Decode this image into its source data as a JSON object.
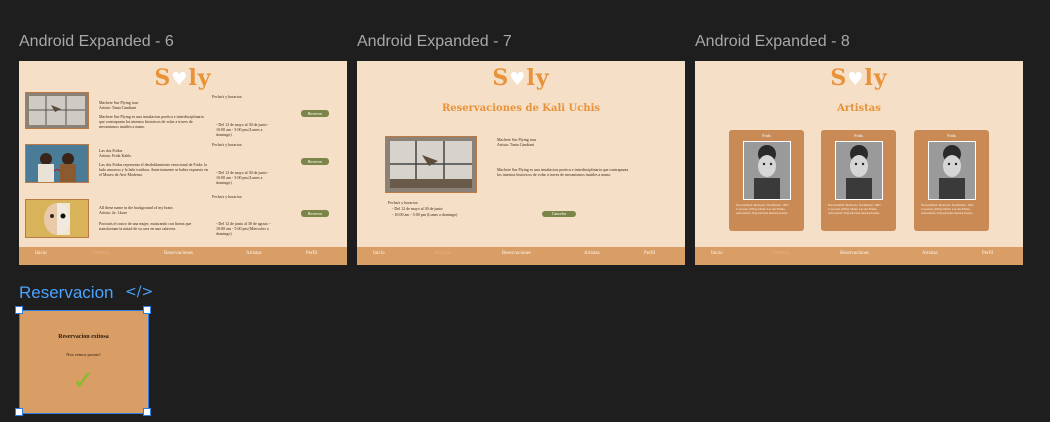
{
  "frames": [
    {
      "label": "Android Expanded - 6"
    },
    {
      "label": "Android Expanded - 7"
    },
    {
      "label": "Android Expanded - 8"
    }
  ],
  "logo": {
    "text_pre": "S",
    "text_post": "ly"
  },
  "nav": [
    "Inicio",
    "Eventos",
    "Reservaciones",
    "Artistas",
    "Perfil"
  ],
  "frame6": {
    "events": [
      {
        "title": "Machete Sur Flying tour",
        "artist": "Artista: Tania Candiani",
        "desc": "Machete Sur Flying es una instalacion poetica e interdisciplinaria que contrapunta los intentos historicos de volar a traves de mecanismos inutiles a mano.",
        "dates_label": "Fecha/s y horarios:",
        "dates": "- Del 12 de mayo al 30 de junio - 10:00 am - 5:00 pm (Lunes a domingo)",
        "button": "Reservar"
      },
      {
        "title": "Las dos Fridas",
        "artist": "Artista: Frida Kahlo",
        "desc": "Las dos Fridas representa el desdoblamiento emocional de Frida: la lado amoroso y la lado traidora. Anteriormente se habia expuesto en el Museo de Arte Moderno.",
        "dates_label": "Fecha/s y horarios:",
        "dates": "- Del 12 de mayo al 30 de junio - 10:00 am - 5:00 pm (Lunes a domingo)",
        "button": "Reservar"
      },
      {
        "title": "All these name in the background of my brain",
        "artist": "Artista: Ja: Lkore",
        "desc": "Portraits el rostro de una mujer, mostrando con lineas que transforman la mitad de su cara en una calavera.",
        "dates_label": "Fecha/s y horarios:",
        "dates": "- Del 12 de junio al 30 de agosto - 10:00 am - 5:00 pm (Miercoles a domingo)",
        "button": "Reservar"
      }
    ]
  },
  "frame7": {
    "title": "Reservaciones de Kali Uchis",
    "event_title": "Machete Sur Flying tour",
    "artist": "Artista: Tania Candiani",
    "desc": "Machete Sur Flying es una instalacion poetica e interdisciplinaria que contrapunta los intentos historicos de volar a traves de mecanismos inutiles a mano.",
    "dates_label": "Fecha/s y horarios:",
    "dates": [
      "- Del 12 de mayo al 30 de junio",
      "- 10:00 am - 5:00 pm (Lunes a domingo)"
    ],
    "button": "Cancelar"
  },
  "frame8": {
    "title": "Artistas",
    "cards": [
      {
        "name": "Frida",
        "info": "Nacionalidad: Mexicana. Nacimiento: 1907, Coyoacan (1954). Obras: Las dos Fridas, Autorretrato. Exposiciones internacionales."
      },
      {
        "name": "Frida",
        "info": "Nacionalidad: Mexicana. Nacimiento: 1907, Coyoacan (1954). Obras: Las dos Fridas, Autorretrato. Exposiciones internacionales."
      },
      {
        "name": "Frida",
        "info": "Nacionalidad: Mexicana. Nacimiento: 1907, Coyoacan (1954). Obras: Las dos Fridas, Autorretrato. Exposiciones internacionales."
      }
    ]
  },
  "reservacion": {
    "label": "Reservacion",
    "code_icon": "</>",
    "title": "Reservacion exitosa",
    "subtitle": "Nos vemos pronto!",
    "check": "✓",
    "check_color": "#7fbf2a",
    "background": "#d99d66"
  },
  "colors": {
    "canvas": "#1e1e1e",
    "frame_bg": "#f5dfc6",
    "accent": "#e8923a",
    "nav_bg": "#d99d66",
    "button": "#7b8547",
    "selection": "#2f7fe0"
  }
}
